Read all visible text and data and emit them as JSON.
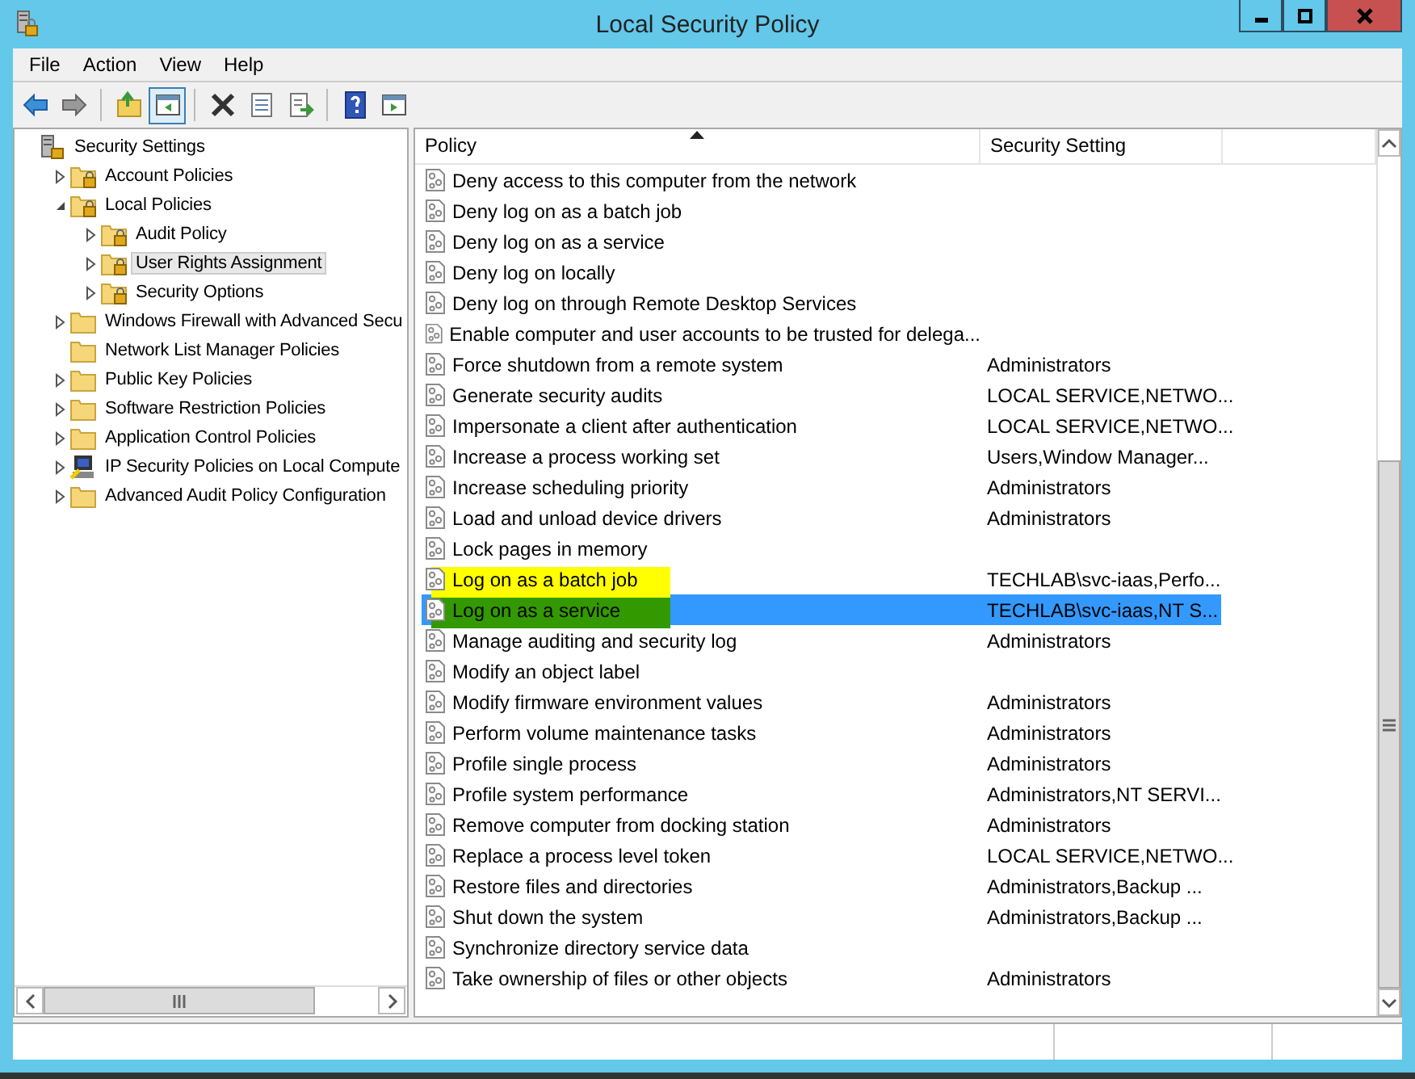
{
  "window": {
    "title": "Local Security Policy"
  },
  "menu": [
    "File",
    "Action",
    "View",
    "Help"
  ],
  "toolbar": [
    {
      "kind": "back",
      "selected": false
    },
    {
      "kind": "forward",
      "selected": false
    },
    {
      "kind": "sep"
    },
    {
      "kind": "up",
      "selected": false
    },
    {
      "kind": "tree",
      "selected": true
    },
    {
      "kind": "sep"
    },
    {
      "kind": "delete",
      "selected": false
    },
    {
      "kind": "properties",
      "selected": false
    },
    {
      "kind": "export",
      "selected": false
    },
    {
      "kind": "sep"
    },
    {
      "kind": "help",
      "selected": false
    },
    {
      "kind": "pane",
      "selected": false
    }
  ],
  "tree": [
    {
      "label": "Security Settings",
      "kind": "server",
      "selected": false,
      "children": [
        {
          "label": "Account Policies",
          "kind": "lockfolder",
          "expanded": false,
          "selected": false
        },
        {
          "label": "Local Policies",
          "kind": "lockfolder",
          "expanded": true,
          "selected": false,
          "children": [
            {
              "label": "Audit Policy",
              "kind": "lockfolder",
              "expanded": false,
              "selected": false
            },
            {
              "label": "User Rights Assignment",
              "kind": "lockfolder",
              "expanded": false,
              "selected": true
            },
            {
              "label": "Security Options",
              "kind": "lockfolder",
              "expanded": false,
              "selected": false
            }
          ]
        },
        {
          "label": "Windows Firewall with Advanced Secu",
          "kind": "folder",
          "expanded": false,
          "selected": false
        },
        {
          "label": "Network List Manager Policies",
          "kind": "folder",
          "selected": false
        },
        {
          "label": "Public Key Policies",
          "kind": "folder",
          "expanded": false,
          "selected": false
        },
        {
          "label": "Software Restriction Policies",
          "kind": "folder",
          "expanded": false,
          "selected": false
        },
        {
          "label": "Application Control Policies",
          "kind": "folder",
          "expanded": false,
          "selected": false
        },
        {
          "label": "IP Security Policies on Local Compute",
          "kind": "computer",
          "expanded": false,
          "selected": false
        },
        {
          "label": "Advanced Audit Policy Configuration",
          "kind": "folder",
          "expanded": false,
          "selected": false
        }
      ]
    }
  ],
  "table": {
    "columns": [
      {
        "label": "Policy",
        "sorted": true
      },
      {
        "label": "Security Setting",
        "sorted": false
      }
    ],
    "rows": [
      {
        "policy": "Deny access to this computer from the network",
        "setting": "",
        "selected": false
      },
      {
        "policy": "Deny log on as a batch job",
        "setting": "",
        "selected": false
      },
      {
        "policy": "Deny log on as a service",
        "setting": "",
        "selected": false
      },
      {
        "policy": "Deny log on locally",
        "setting": "",
        "selected": false
      },
      {
        "policy": "Deny log on through Remote Desktop Services",
        "setting": "",
        "selected": false
      },
      {
        "policy": "Enable computer and user accounts to be trusted for delega...",
        "setting": "",
        "selected": false
      },
      {
        "policy": "Force shutdown from a remote system",
        "setting": "Administrators",
        "selected": false
      },
      {
        "policy": "Generate security audits",
        "setting": "LOCAL SERVICE,NETWO...",
        "selected": false
      },
      {
        "policy": "Impersonate a client after authentication",
        "setting": "LOCAL SERVICE,NETWO...",
        "selected": false
      },
      {
        "policy": "Increase a process working set",
        "setting": "Users,Window Manager...",
        "selected": false
      },
      {
        "policy": "Increase scheduling priority",
        "setting": "Administrators",
        "selected": false
      },
      {
        "policy": "Load and unload device drivers",
        "setting": "Administrators",
        "selected": false
      },
      {
        "policy": "Lock pages in memory",
        "setting": "",
        "selected": false
      },
      {
        "policy": "Log on as a batch job",
        "setting": "TECHLAB\\svc-iaas,Perfo...",
        "selected": false,
        "color": "#ffff00"
      },
      {
        "policy": "Log on as a service",
        "setting": "TECHLAB\\svc-iaas,NT S...",
        "selected": true,
        "color": "#339900"
      },
      {
        "policy": "Manage auditing and security log",
        "setting": "Administrators",
        "selected": false
      },
      {
        "policy": "Modify an object label",
        "setting": "",
        "selected": false
      },
      {
        "policy": "Modify firmware environment values",
        "setting": "Administrators",
        "selected": false
      },
      {
        "policy": "Perform volume maintenance tasks",
        "setting": "Administrators",
        "selected": false
      },
      {
        "policy": "Profile single process",
        "setting": "Administrators",
        "selected": false
      },
      {
        "policy": "Profile system performance",
        "setting": "Administrators,NT SERVI...",
        "selected": false
      },
      {
        "policy": "Remove computer from docking station",
        "setting": "Administrators",
        "selected": false
      },
      {
        "policy": "Replace a process level token",
        "setting": "LOCAL SERVICE,NETWO...",
        "selected": false
      },
      {
        "policy": "Restore files and directories",
        "setting": "Administrators,Backup ...",
        "selected": false
      },
      {
        "policy": "Shut down the system",
        "setting": "Administrators,Backup ...",
        "selected": false
      },
      {
        "policy": "Synchronize directory service data",
        "setting": "",
        "selected": false
      },
      {
        "policy": "Take ownership of files or other objects",
        "setting": "Administrators",
        "selected": false
      }
    ]
  }
}
